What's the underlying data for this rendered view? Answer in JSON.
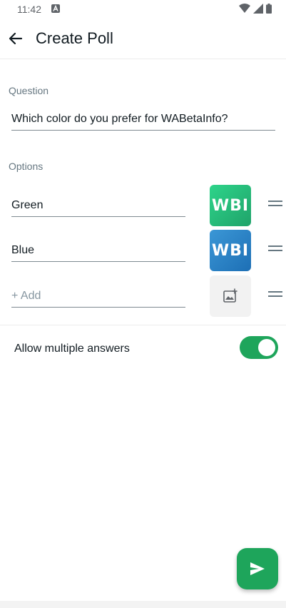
{
  "status_bar": {
    "time": "11:42",
    "icons": [
      "notification-a-icon",
      "wifi-icon",
      "signal-icon",
      "battery-icon"
    ]
  },
  "app_bar": {
    "title": "Create Poll",
    "back_icon": "arrow-left-icon"
  },
  "question": {
    "label": "Question",
    "value": "Which color do you prefer for WABetaInfo?"
  },
  "options": {
    "label": "Options",
    "items": [
      {
        "value": "Green",
        "thumb_text": "WBI",
        "thumb_color": "#22bf7a"
      },
      {
        "value": "Blue",
        "thumb_text": "WBI",
        "thumb_color": "#2a82c6"
      }
    ],
    "add_placeholder": "+ Add",
    "add_image_icon": "add-image-icon"
  },
  "allow_multiple": {
    "label": "Allow multiple answers",
    "enabled": true
  },
  "send_button": {
    "icon": "send-icon"
  },
  "colors": {
    "accent": "#1ea55b",
    "text": "#111b21",
    "secondary_text": "#667781"
  }
}
